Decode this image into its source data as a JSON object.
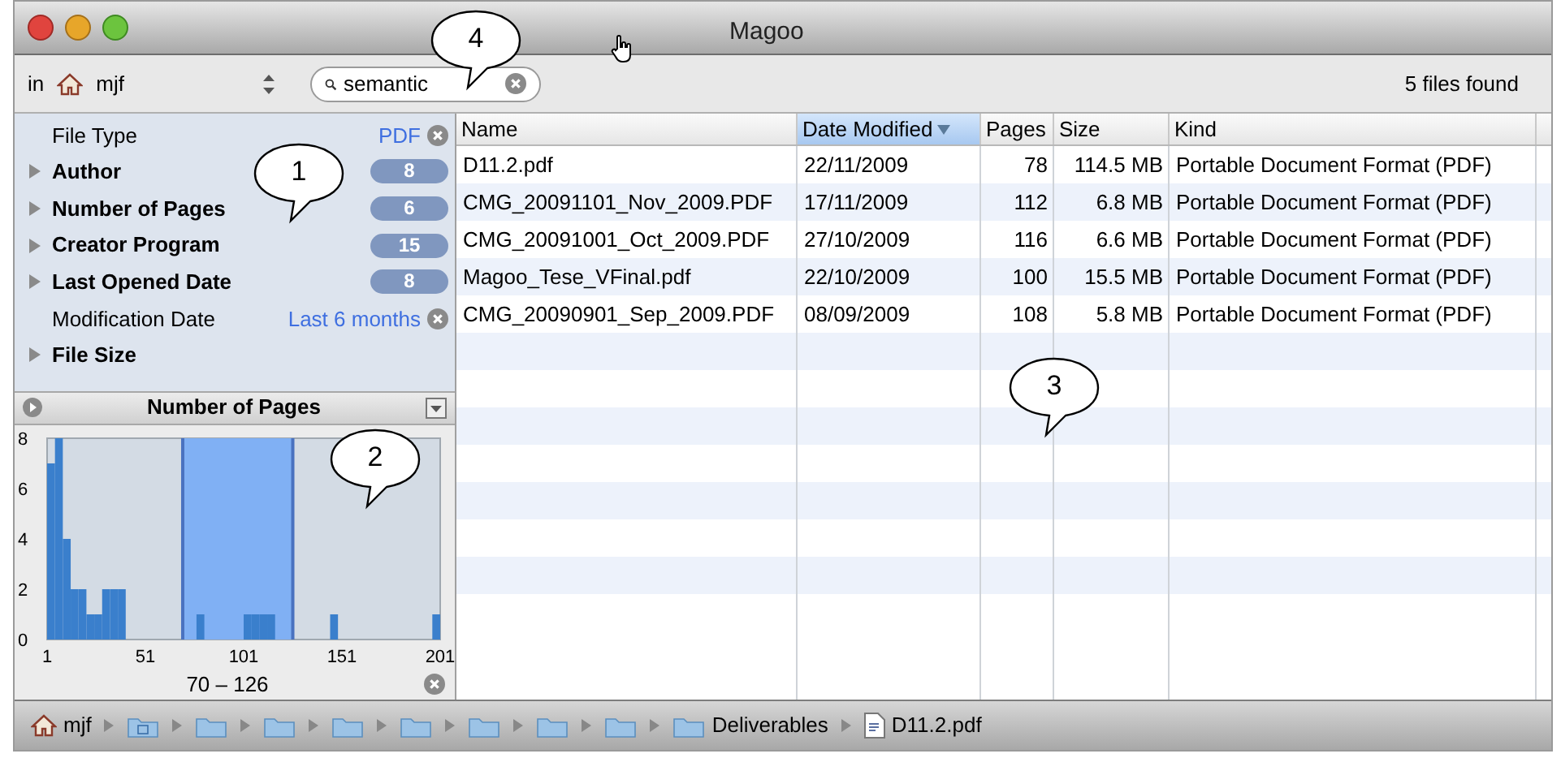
{
  "window": {
    "title": "Magoo"
  },
  "toolbar": {
    "scope_prefix": "in",
    "scope": "mjf",
    "search": {
      "value": "semantic"
    },
    "result_count": "5 files found"
  },
  "filters": [
    {
      "kind": "value",
      "label": "File Type",
      "value": "PDF"
    },
    {
      "kind": "group",
      "label": "Author",
      "count": "8",
      "expanded": false
    },
    {
      "kind": "group",
      "label": "Number of Pages",
      "count": "6",
      "expanded": false
    },
    {
      "kind": "group",
      "label": "Creator Program",
      "count": "15",
      "expanded": false
    },
    {
      "kind": "group",
      "label": "Last Opened Date",
      "count": "8",
      "expanded": false
    },
    {
      "kind": "value",
      "label": "Modification Date",
      "value": "Last 6 months"
    },
    {
      "kind": "group",
      "label": "File Size",
      "expanded": false
    }
  ],
  "histogram": {
    "title": "Number of Pages",
    "range": "70 – 126",
    "chart_data": {
      "type": "bar",
      "x": [
        1,
        5,
        9,
        13,
        17,
        21,
        25,
        29,
        33,
        37,
        41,
        45,
        49,
        53,
        57,
        61,
        65,
        69,
        73,
        77,
        81,
        85,
        89,
        93,
        97,
        101,
        105,
        109,
        113,
        117,
        121,
        125,
        129,
        133,
        137,
        141,
        145,
        149,
        153,
        157,
        161,
        165,
        169,
        173,
        177,
        181,
        185,
        189,
        193,
        197
      ],
      "values": [
        7,
        8,
        4,
        2,
        2,
        1,
        1,
        2,
        2,
        2,
        0,
        0,
        0,
        0,
        0,
        0,
        0,
        0,
        0,
        1,
        0,
        0,
        0,
        0,
        0,
        1,
        1,
        1,
        1,
        0,
        0,
        0,
        0,
        0,
        0,
        0,
        1,
        0,
        0,
        0,
        0,
        0,
        0,
        0,
        0,
        0,
        0,
        0,
        0,
        1
      ],
      "xlim": [
        1,
        201
      ],
      "ylim": [
        0,
        8
      ],
      "xticks": [
        1,
        51,
        101,
        151,
        201
      ],
      "yticks": [
        0,
        2,
        4,
        6,
        8
      ]
    },
    "range_handles": [
      {
        "level": 0.345
      },
      {
        "level": 0.625
      }
    ]
  },
  "table": {
    "columns": [
      {
        "label": "Name",
        "selected": false
      },
      {
        "label": "Date Modified",
        "selected": true
      },
      {
        "label": "Pages",
        "selected": false
      },
      {
        "label": "Size",
        "selected": false
      },
      {
        "label": "Kind",
        "selected": false
      }
    ],
    "rows": [
      [
        "D11.2.pdf",
        "22/11/2009",
        "78",
        "114.5 MB",
        "Portable Document Format (PDF)"
      ],
      [
        "CMG_20091101_Nov_2009.PDF",
        "17/11/2009",
        "112",
        "6.8 MB",
        "Portable Document Format (PDF)"
      ],
      [
        "CMG_20091001_Oct_2009.PDF",
        "27/10/2009",
        "116",
        "6.6 MB",
        "Portable Document Format (PDF)"
      ],
      [
        "Magoo_Tese_VFinal.pdf",
        "22/10/2009",
        "100",
        "15.5 MB",
        "Portable Document Format (PDF)"
      ],
      [
        "CMG_20090901_Sep_2009.PDF",
        "08/09/2009",
        "108",
        "5.8 MB",
        "Portable Document Format (PDF)"
      ]
    ]
  },
  "path_bar": [
    {
      "kind": "home",
      "label": "mjf"
    },
    {
      "kind": "special-folder"
    },
    {
      "kind": "folder"
    },
    {
      "kind": "folder"
    },
    {
      "kind": "folder"
    },
    {
      "kind": "folder"
    },
    {
      "kind": "folder"
    },
    {
      "kind": "folder"
    },
    {
      "kind": "folder"
    },
    {
      "kind": "folder",
      "label": "Deliverables"
    },
    {
      "kind": "file",
      "label": "D11.2.pdf"
    }
  ],
  "callouts": [
    {
      "label": "4"
    },
    {
      "label": "1"
    },
    {
      "label": "2"
    },
    {
      "label": "3"
    }
  ]
}
